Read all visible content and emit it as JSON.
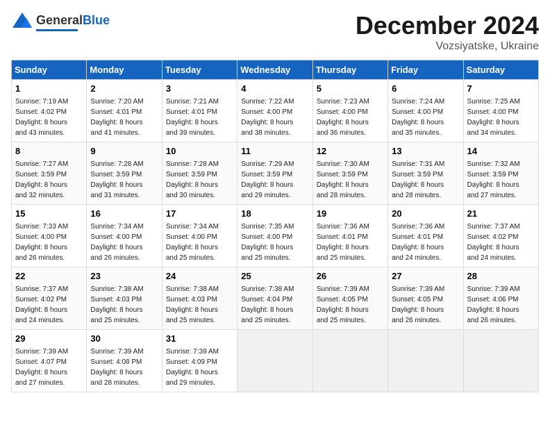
{
  "header": {
    "logo_general": "General",
    "logo_blue": "Blue",
    "month": "December 2024",
    "location": "Vozsiyatske, Ukraine"
  },
  "days_of_week": [
    "Sunday",
    "Monday",
    "Tuesday",
    "Wednesday",
    "Thursday",
    "Friday",
    "Saturday"
  ],
  "weeks": [
    [
      {
        "day": 1,
        "info": "Sunrise: 7:19 AM\nSunset: 4:02 PM\nDaylight: 8 hours\nand 43 minutes."
      },
      {
        "day": 2,
        "info": "Sunrise: 7:20 AM\nSunset: 4:01 PM\nDaylight: 8 hours\nand 41 minutes."
      },
      {
        "day": 3,
        "info": "Sunrise: 7:21 AM\nSunset: 4:01 PM\nDaylight: 8 hours\nand 39 minutes."
      },
      {
        "day": 4,
        "info": "Sunrise: 7:22 AM\nSunset: 4:00 PM\nDaylight: 8 hours\nand 38 minutes."
      },
      {
        "day": 5,
        "info": "Sunrise: 7:23 AM\nSunset: 4:00 PM\nDaylight: 8 hours\nand 36 minutes."
      },
      {
        "day": 6,
        "info": "Sunrise: 7:24 AM\nSunset: 4:00 PM\nDaylight: 8 hours\nand 35 minutes."
      },
      {
        "day": 7,
        "info": "Sunrise: 7:25 AM\nSunset: 4:00 PM\nDaylight: 8 hours\nand 34 minutes."
      }
    ],
    [
      {
        "day": 8,
        "info": "Sunrise: 7:27 AM\nSunset: 3:59 PM\nDaylight: 8 hours\nand 32 minutes."
      },
      {
        "day": 9,
        "info": "Sunrise: 7:28 AM\nSunset: 3:59 PM\nDaylight: 8 hours\nand 31 minutes."
      },
      {
        "day": 10,
        "info": "Sunrise: 7:28 AM\nSunset: 3:59 PM\nDaylight: 8 hours\nand 30 minutes."
      },
      {
        "day": 11,
        "info": "Sunrise: 7:29 AM\nSunset: 3:59 PM\nDaylight: 8 hours\nand 29 minutes."
      },
      {
        "day": 12,
        "info": "Sunrise: 7:30 AM\nSunset: 3:59 PM\nDaylight: 8 hours\nand 28 minutes."
      },
      {
        "day": 13,
        "info": "Sunrise: 7:31 AM\nSunset: 3:59 PM\nDaylight: 8 hours\nand 28 minutes."
      },
      {
        "day": 14,
        "info": "Sunrise: 7:32 AM\nSunset: 3:59 PM\nDaylight: 8 hours\nand 27 minutes."
      }
    ],
    [
      {
        "day": 15,
        "info": "Sunrise: 7:33 AM\nSunset: 4:00 PM\nDaylight: 8 hours\nand 26 minutes."
      },
      {
        "day": 16,
        "info": "Sunrise: 7:34 AM\nSunset: 4:00 PM\nDaylight: 8 hours\nand 26 minutes."
      },
      {
        "day": 17,
        "info": "Sunrise: 7:34 AM\nSunset: 4:00 PM\nDaylight: 8 hours\nand 25 minutes."
      },
      {
        "day": 18,
        "info": "Sunrise: 7:35 AM\nSunset: 4:00 PM\nDaylight: 8 hours\nand 25 minutes."
      },
      {
        "day": 19,
        "info": "Sunrise: 7:36 AM\nSunset: 4:01 PM\nDaylight: 8 hours\nand 25 minutes."
      },
      {
        "day": 20,
        "info": "Sunrise: 7:36 AM\nSunset: 4:01 PM\nDaylight: 8 hours\nand 24 minutes."
      },
      {
        "day": 21,
        "info": "Sunrise: 7:37 AM\nSunset: 4:02 PM\nDaylight: 8 hours\nand 24 minutes."
      }
    ],
    [
      {
        "day": 22,
        "info": "Sunrise: 7:37 AM\nSunset: 4:02 PM\nDaylight: 8 hours\nand 24 minutes."
      },
      {
        "day": 23,
        "info": "Sunrise: 7:38 AM\nSunset: 4:03 PM\nDaylight: 8 hours\nand 25 minutes."
      },
      {
        "day": 24,
        "info": "Sunrise: 7:38 AM\nSunset: 4:03 PM\nDaylight: 8 hours\nand 25 minutes."
      },
      {
        "day": 25,
        "info": "Sunrise: 7:38 AM\nSunset: 4:04 PM\nDaylight: 8 hours\nand 25 minutes."
      },
      {
        "day": 26,
        "info": "Sunrise: 7:39 AM\nSunset: 4:05 PM\nDaylight: 8 hours\nand 25 minutes."
      },
      {
        "day": 27,
        "info": "Sunrise: 7:39 AM\nSunset: 4:05 PM\nDaylight: 8 hours\nand 26 minutes."
      },
      {
        "day": 28,
        "info": "Sunrise: 7:39 AM\nSunset: 4:06 PM\nDaylight: 8 hours\nand 26 minutes."
      }
    ],
    [
      {
        "day": 29,
        "info": "Sunrise: 7:39 AM\nSunset: 4:07 PM\nDaylight: 8 hours\nand 27 minutes."
      },
      {
        "day": 30,
        "info": "Sunrise: 7:39 AM\nSunset: 4:08 PM\nDaylight: 8 hours\nand 28 minutes."
      },
      {
        "day": 31,
        "info": "Sunrise: 7:39 AM\nSunset: 4:09 PM\nDaylight: 8 hours\nand 29 minutes."
      },
      null,
      null,
      null,
      null
    ]
  ]
}
